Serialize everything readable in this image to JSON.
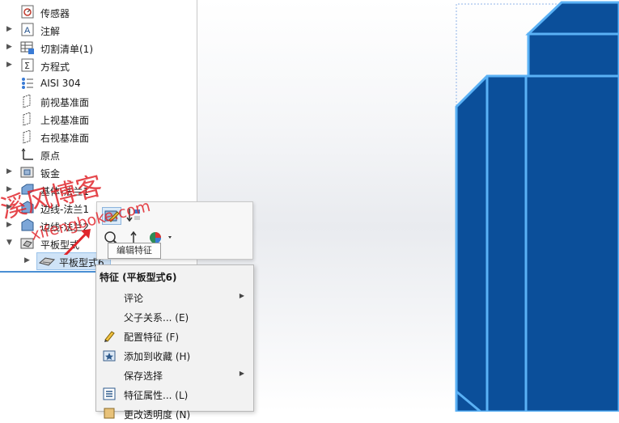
{
  "tree": {
    "items": [
      {
        "label": "传感器",
        "icon": "sensor-icon",
        "expandable": false
      },
      {
        "label": "注解",
        "icon": "annotation-icon",
        "expandable": true
      },
      {
        "label": "切割清单(1)",
        "icon": "cut-list-icon",
        "expandable": true
      },
      {
        "label": "方程式",
        "icon": "equation-icon",
        "expandable": true
      },
      {
        "label": "AISI 304",
        "icon": "material-icon",
        "expandable": false
      },
      {
        "label": "前视基准面",
        "icon": "plane-icon",
        "expandable": false
      },
      {
        "label": "上视基准面",
        "icon": "plane-icon",
        "expandable": false
      },
      {
        "label": "右视基准面",
        "icon": "plane-icon",
        "expandable": false
      },
      {
        "label": "原点",
        "icon": "origin-icon",
        "expandable": false
      },
      {
        "label": "钣金",
        "icon": "sheet-metal-icon",
        "expandable": true
      },
      {
        "label": "基体-法兰1",
        "icon": "base-flange-icon",
        "expandable": true
      },
      {
        "label": "边线-法兰1",
        "icon": "edge-flange-icon",
        "expandable": true
      },
      {
        "label": "边线-法兰2",
        "icon": "edge-flange-icon",
        "expandable": true
      },
      {
        "label": "平板型式",
        "icon": "flat-pattern-icon",
        "expandable": true
      }
    ],
    "selected_child": {
      "label": "平板型式6",
      "icon": "flat-pattern-feature-icon"
    }
  },
  "context_toolbar": {
    "tooltip": "编辑特征"
  },
  "context_menu": {
    "title": "特征 (平板型式6)",
    "items": [
      {
        "label": "评论",
        "icon": "",
        "submenu": true
      },
      {
        "label": "父子关系... (E)",
        "icon": "",
        "submenu": false
      },
      {
        "label": "配置特征 (F)",
        "icon": "pencil-icon",
        "submenu": false
      },
      {
        "label": "添加到收藏 (H)",
        "icon": "favorite-star-icon",
        "submenu": false
      },
      {
        "label": "保存选择",
        "icon": "",
        "submenu": true
      },
      {
        "label": "特征属性... (L)",
        "icon": "properties-icon",
        "submenu": false
      },
      {
        "label": "更改透明度 (N)",
        "icon": "transparency-icon",
        "submenu": false
      }
    ]
  },
  "watermark": {
    "line1": "溪风博客",
    "line2": "xifengboke.com"
  },
  "colors": {
    "model_fill": "#0b4f9a",
    "model_edge": "#5ab1f5",
    "selection": "#cfe3f7",
    "watermark": "#e0262b"
  }
}
